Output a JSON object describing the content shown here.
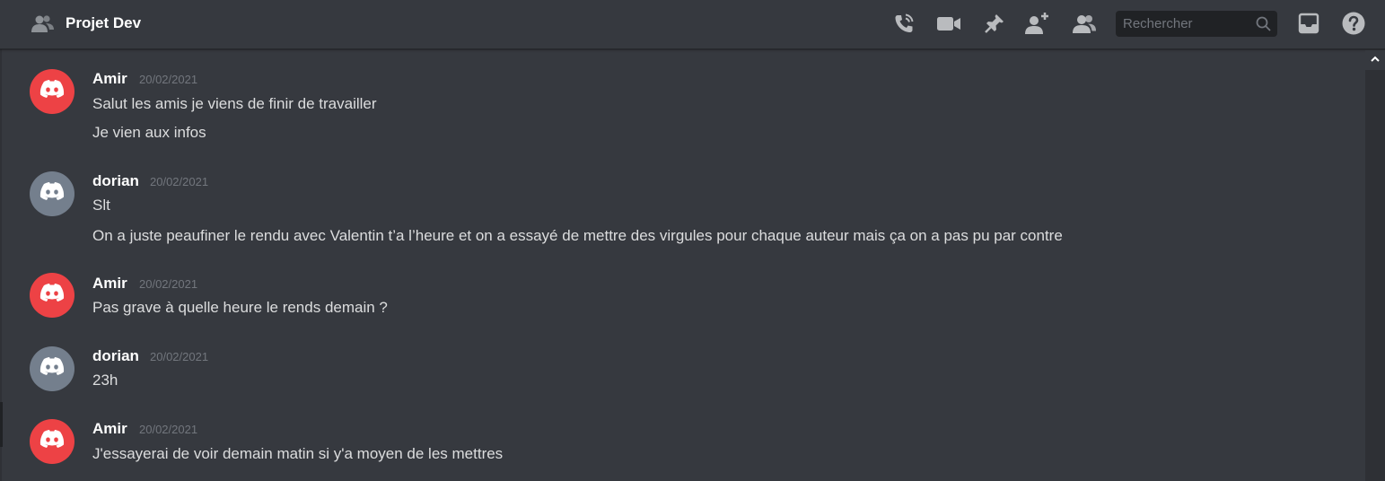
{
  "header": {
    "channel_name": "Projet Dev",
    "search_placeholder": "Rechercher",
    "tools": [
      "voice-call-icon",
      "video-call-icon",
      "pin-icon",
      "add-member-icon",
      "member-list-icon",
      "inbox-icon",
      "help-icon"
    ]
  },
  "messages": [
    {
      "author": "Amir",
      "avatar": "red",
      "timestamp": "20/02/2021",
      "lines": [
        "Salut les amis je viens de finir de travailler",
        "Je vien aux infos"
      ]
    },
    {
      "author": "dorian",
      "avatar": "grey",
      "timestamp": "20/02/2021",
      "lines": [
        "Slt",
        "On a juste peaufiner  le rendu avec Valentin t’a l’heure et on a essayé de mettre des virgules pour chaque auteur mais ça on a pas pu par contre"
      ]
    },
    {
      "author": "Amir",
      "avatar": "red",
      "timestamp": "20/02/2021",
      "lines": [
        "Pas grave à quelle heure le rends demain ?"
      ]
    },
    {
      "author": "dorian",
      "avatar": "grey",
      "timestamp": "20/02/2021",
      "lines": [
        "23h"
      ]
    },
    {
      "author": "Amir",
      "avatar": "red",
      "timestamp": "20/02/2021",
      "lines": [
        "J'essayerai de voir demain matin si y'a moyen de les mettres"
      ]
    }
  ],
  "colors": {
    "background": "#36393f",
    "header_text": "#ffffff",
    "avatar_red": "#ed4245",
    "avatar_grey": "#747f8d",
    "timestamp": "#72767d"
  }
}
